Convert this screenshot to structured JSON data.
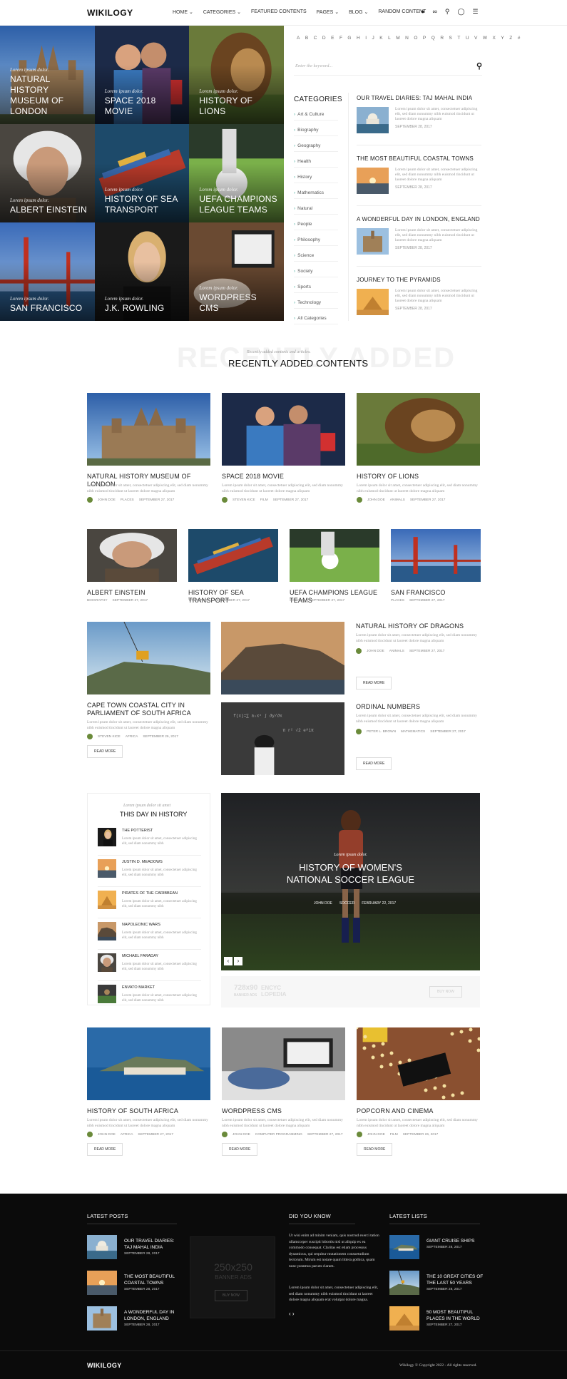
{
  "header": {
    "logo": "WIKILOGY",
    "nav": [
      "HOME ⌄",
      "CATEGORIES ⌄",
      "FEATURED CONTENTS",
      "PAGES ⌄",
      "BLOG ⌄",
      "RANDOM CONTENT"
    ],
    "icons": [
      "user-icon",
      "share-icon",
      "search-icon",
      "globe-icon",
      "menu-icon"
    ]
  },
  "hero": [
    {
      "lead": "Lorem ipsum dolor.",
      "title": "NATURAL HISTORY MUSEUM OF LONDON"
    },
    {
      "lead": "Lorem ipsum dolor.",
      "title": "SPACE 2018 MOVIE"
    },
    {
      "lead": "Lorem ipsum dolor.",
      "title": "HISTORY OF LIONS"
    },
    {
      "lead": "Lorem ipsum dolor.",
      "title": "ALBERT EINSTEIN"
    },
    {
      "lead": "Lorem ipsum dolor.",
      "title": "HISTORY OF SEA TRANSPORT"
    },
    {
      "lead": "Lorem ipsum dolor.",
      "title": "UEFA CHAMPIONS LEAGUE TEAMS"
    },
    {
      "lead": "Lorem ipsum dolor.",
      "title": "SAN FRANCISCO"
    },
    {
      "lead": "Lorem ipsum dolor.",
      "title": "J.K. ROWLING"
    },
    {
      "lead": "Lorem ipsum dolor.",
      "title": "WORDPRESS CMS"
    }
  ],
  "alphabet": [
    "A",
    "B",
    "C",
    "D",
    "E",
    "F",
    "G",
    "H",
    "I",
    "J",
    "K",
    "L",
    "M",
    "N",
    "O",
    "P",
    "Q",
    "R",
    "S",
    "T",
    "U",
    "V",
    "W",
    "X",
    "Y",
    "Z",
    "#"
  ],
  "search": {
    "placeholder": "Enter the keyword..."
  },
  "categories": {
    "heading": "CATEGORIES",
    "items": [
      "Art & Culture",
      "Biography",
      "Geography",
      "Health",
      "History",
      "Mathematics",
      "Natural",
      "People",
      "Philosophy",
      "Science",
      "Society",
      "Sports",
      "Technology",
      "All Categories"
    ]
  },
  "side_posts": [
    {
      "title": "OUR TRAVEL DIARIES: TAJ MAHAL INDIA",
      "excerpt": "Lorem ipsum dolor sit amet, consectetuer adipiscing elit, sed diam nonummy nibh euismod tincidunt ut laoreet dolore magna aliquam",
      "date": "SEPTEMBER 28, 2017"
    },
    {
      "title": "THE MOST BEAUTIFUL COASTAL TOWNS",
      "excerpt": "Lorem ipsum dolor sit amet, consectetuer adipiscing elit, sed diam nonummy nibh euismod tincidunt ut laoreet dolore magna aliquam",
      "date": "SEPTEMBER 28, 2017"
    },
    {
      "title": "A WONDERFUL DAY IN LONDON, ENGLAND",
      "excerpt": "Lorem ipsum dolor sit amet, consectetuer adipiscing elit, sed diam nonummy nibh euismod tincidunt ut laoreet dolore magna aliquam",
      "date": "SEPTEMBER 28, 2017"
    },
    {
      "title": "JOURNEY TO THE PYRAMIDS",
      "excerpt": "Lorem ipsum dolor sit amet, consectetuer adipiscing elit, sed diam nonummy nibh euismod tincidunt ut laoreet dolore magna aliquam",
      "date": "SEPTEMBER 28, 2017"
    }
  ],
  "recent": {
    "bg_text": "RECENTLY ADDED",
    "sub": "Recently added contents and articles.",
    "heading": "RECENTLY ADDED CONTENTS"
  },
  "excerpt": "Lorem ipsum dolor sit amet, consectetuer adipiscing elit, sed diam nonummy nibh euismod tincidunt ut laoreet dolore magna aliquam",
  "row1": [
    {
      "title": "NATURAL HISTORY MUSEUM OF LONDON",
      "author": "JOHN DOE",
      "cat": "PLACES",
      "date": "SEPTEMBER 27, 2017"
    },
    {
      "title": "SPACE 2018 MOVIE",
      "author": "STEVEN KICE",
      "cat": "FILM",
      "date": "SEPTEMBER 27, 2017"
    },
    {
      "title": "HISTORY OF LIONS",
      "author": "JOHN DOE",
      "cat": "ANIMALS",
      "date": "SEPTEMBER 27, 2017"
    }
  ],
  "row2": [
    {
      "title": "ALBERT EINSTEIN",
      "cat": "BIOGRAPHY",
      "date": "SEPTEMBER 27, 2017"
    },
    {
      "title": "HISTORY OF SEA TRANSPORT",
      "cat": "TRANSPORT",
      "date": "SEPTEMBER 27, 2017"
    },
    {
      "title": "UEFA CHAMPIONS LEAGUE TEAMS",
      "cat": "SOCCER",
      "date": "SEPTEMBER 27, 2017"
    },
    {
      "title": "SAN FRANCISCO",
      "cat": "PLACES",
      "date": "SEPTEMBER 27, 2017"
    }
  ],
  "row3": {
    "capetown": {
      "title": "CAPE TOWN COASTAL CITY IN PARLIAMENT OF SOUTH AFRICA",
      "author": "STEVEN KICE",
      "cat": "AFRICA",
      "date": "SEPTEMBER 26, 2017"
    },
    "dragons": {
      "title": "NATURAL HISTORY OF DRAGONS",
      "author": "JOHN DOE",
      "cat": "ANIMALS",
      "date": "SEPTEMBER 27, 2017"
    },
    "numbers": {
      "title": "ORDINAL NUMBERS",
      "author": "PETER L. BROWN",
      "cat": "MATHEMATICS",
      "date": "SEPTEMBER 27, 2017"
    },
    "read_more": "READ MORE"
  },
  "today": {
    "sub": "Lorem ipsum dolor sit amet",
    "heading": "THIS DAY IN HISTORY",
    "items": [
      {
        "title": "THE POTTERIST",
        "text": "Lorem ipsum dolor sit amet, consectetuer adipiscing elit, sed diam nonummy nibh"
      },
      {
        "title": "JUSTIN D. MEADOWS",
        "text": "Lorem ipsum dolor sit amet, consectetuer adipiscing elit, sed diam nonummy nibh"
      },
      {
        "title": "PIRATES OF THE CARIBBEAN",
        "text": "Lorem ipsum dolor sit amet, consectetuer adipiscing elit, sed diam nonummy nibh"
      },
      {
        "title": "NAPOLEONIC WARS",
        "text": "Lorem ipsum dolor sit amet, consectetuer adipiscing elit, sed diam nonummy nibh"
      },
      {
        "title": "MICHAEL FARADAY",
        "text": "Lorem ipsum dolor sit amet, consectetuer adipiscing elit, sed diam nonummy nibh"
      },
      {
        "title": "ENVATO MARKET",
        "text": "Lorem ipsum dolor sit amet, consectetuer adipiscing elit, sed diam nonummy nibh"
      }
    ]
  },
  "feature": {
    "lead": "Lorem ipsum dolor.",
    "title": "HISTORY OF WOMEN'S NATIONAL SOCCER LEAGUE",
    "author": "JOHN DOE",
    "cat": "SOCCER",
    "date": "FEBRUARY 22, 2017"
  },
  "banner728": {
    "size": "728x90",
    "label": "BANNER ADS",
    "brand": "ENCYC LOPEDIA",
    "button": "BUY NOW"
  },
  "row4": [
    {
      "title": "HISTORY OF SOUTH AFRICA",
      "author": "JOHN DOE",
      "cat": "AFRICA",
      "date": "SEPTEMBER 27, 2017"
    },
    {
      "title": "WORDPRESS CMS",
      "author": "JOHN DOE",
      "cat": "COMPUTER PROGRAMMING",
      "date": "SEPTEMBER 27, 2017"
    },
    {
      "title": "POPCORN AND CINEMA",
      "author": "JOHN DOE",
      "cat": "FILM",
      "date": "SEPTEMBER 26, 2017"
    }
  ],
  "footer": {
    "latest_posts": {
      "heading": "LATEST POSTS",
      "items": [
        {
          "title": "OUR TRAVEL DIARIES: TAJ MAHAL INDIA",
          "date": "SEPTEMBER 28, 2017"
        },
        {
          "title": "THE MOST BEAUTIFUL COASTAL TOWNS",
          "date": "SEPTEMBER 28, 2017"
        },
        {
          "title": "A WONDERFUL DAY IN LONDON, ENGLAND",
          "date": "SEPTEMBER 28, 2017"
        }
      ]
    },
    "banner250": {
      "size": "250x250",
      "label": "BANNER ADS",
      "button": "BUY NOW"
    },
    "did_you_know": {
      "heading": "DID YOU KNOW",
      "p1": "Ut wisi enim ad minim veniam, quis nostrud exerci tation ullamcorper suscipit lobortis nisl ut aliquip ex ea commodo consequat. Claritas est etiam processus dynamicus, qui sequitur mutationem consuetudium lectorum. Mirum est notare quam littera gothica, quam nunc putamus parum claram.",
      "p2": "Lorem ipsum dolor sit amet, consectetuer adipiscing elit, sed diam nonummy nibh euismod tincidunt ut laoreet dolore magna aliquam erat volutpat dolore magna."
    },
    "latest_lists": {
      "heading": "LATEST LISTS",
      "items": [
        {
          "title": "GIANT CRUISE SHIPS",
          "date": "SEPTEMBER 28, 2017"
        },
        {
          "title": "THE 10 GREAT CITIES OF THE LAST 50 YEARS",
          "date": "SEPTEMBER 28, 2017"
        },
        {
          "title": "50 MOST BEAUTIFUL PLACES IN THE WORLD",
          "date": "SEPTEMBER 27, 2017"
        }
      ]
    },
    "logo": "WIKILOGY",
    "copyright": "Wikilogy © Copyright 2022 - All rights reserved."
  }
}
